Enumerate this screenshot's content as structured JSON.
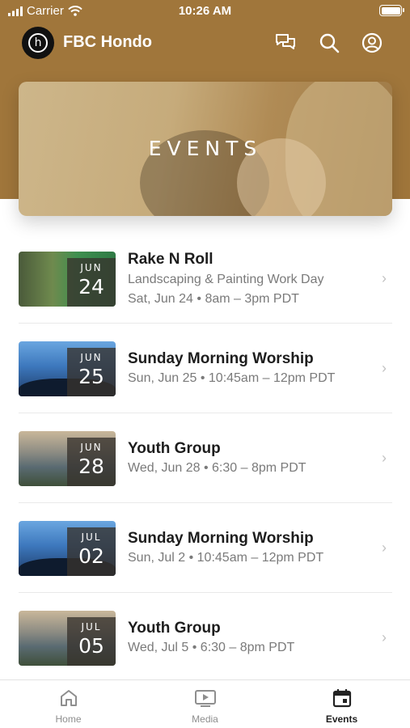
{
  "status_bar": {
    "carrier": "Carrier",
    "time": "10:26 AM"
  },
  "app_bar": {
    "title": "FBC Hondo",
    "logo_letter": "h"
  },
  "banner": {
    "title": "EVENTS"
  },
  "events": [
    {
      "month": "JUN",
      "day": "24",
      "title": "Rake N Roll",
      "subtitle": "Landscaping & Painting Work Day",
      "when": "Sat, Jun 24 • 8am – 3pm PDT",
      "thumbnail": "yard-work"
    },
    {
      "month": "JUN",
      "day": "25",
      "title": "Sunday Morning Worship",
      "when": "Sun, Jun 25 • 10:45am – 12pm PDT",
      "thumbnail": "worship-crowd"
    },
    {
      "month": "JUN",
      "day": "28",
      "title": "Youth Group",
      "when": "Wed, Jun 28 • 6:30 – 8pm PDT",
      "thumbnail": "mountains"
    },
    {
      "month": "JUL",
      "day": "02",
      "title": "Sunday Morning Worship",
      "when": "Sun, Jul 2 • 10:45am – 12pm PDT",
      "thumbnail": "worship-crowd"
    },
    {
      "month": "JUL",
      "day": "05",
      "title": "Youth Group",
      "when": "Wed, Jul 5 • 6:30 – 8pm PDT",
      "thumbnail": "mountains"
    }
  ],
  "tabs": [
    {
      "label": "Home",
      "icon": "home-icon",
      "active": false
    },
    {
      "label": "Media",
      "icon": "media-icon",
      "active": false
    },
    {
      "label": "Events",
      "icon": "calendar-icon",
      "active": true
    }
  ],
  "colors": {
    "brand": "#a0763b",
    "text_primary": "#1d1d1d",
    "text_secondary": "#7a7a7a"
  }
}
